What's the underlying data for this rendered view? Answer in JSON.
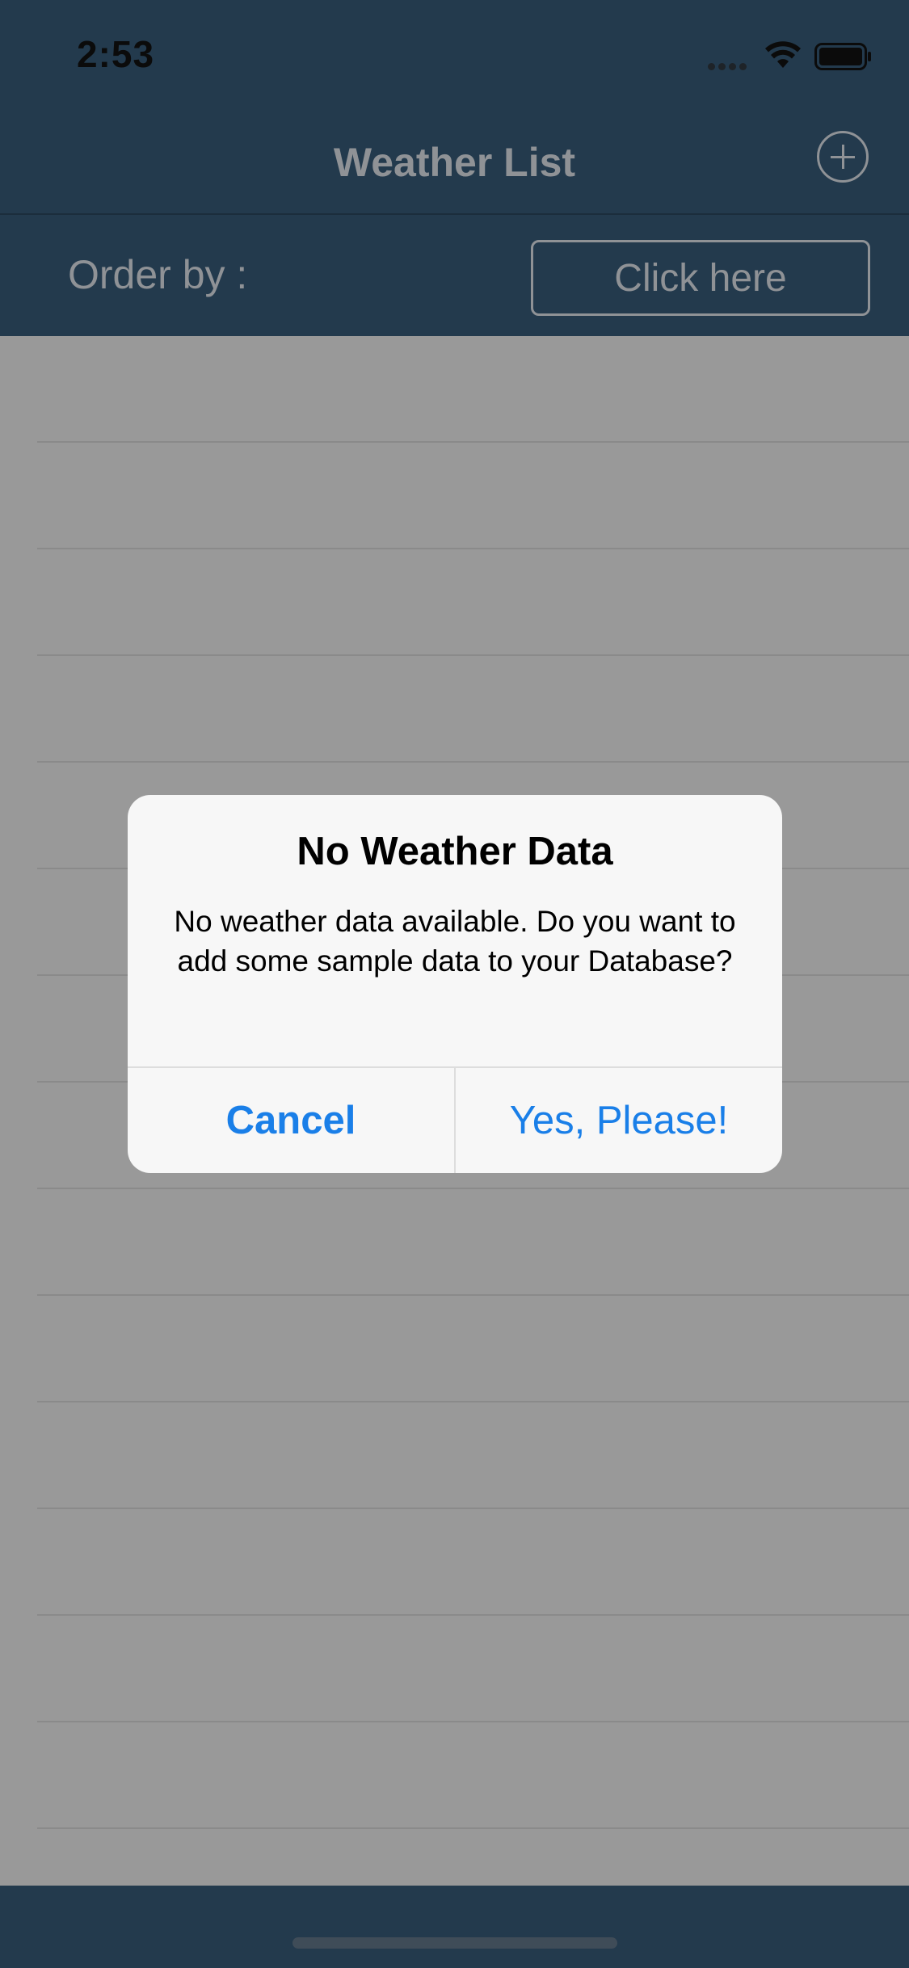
{
  "status_bar": {
    "time": "2:53"
  },
  "nav": {
    "title": "Weather List",
    "add_icon": "plus-circle-icon"
  },
  "order": {
    "label": "Order by :",
    "button_label": "Click here"
  },
  "list": {
    "row_count": 14
  },
  "alert": {
    "title": "No Weather Data",
    "message": "No weather data available. Do you want to add some sample data to your Database?",
    "cancel_label": "Cancel",
    "confirm_label": "Yes, Please!"
  },
  "colors": {
    "header": "#233a4d",
    "dimmed_background": "#999999",
    "alert_background": "#f7f7f7",
    "accent": "#1a7fe8"
  }
}
